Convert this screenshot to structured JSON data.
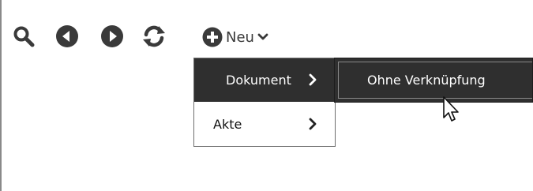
{
  "toolbar": {
    "icons": [
      "search-icon",
      "back-icon",
      "forward-icon",
      "refresh-icon"
    ],
    "new_button": {
      "icon": "plus-circle-icon",
      "label": "Neu",
      "dropdown_icon": "chevron-down-icon"
    }
  },
  "menu": {
    "items": [
      {
        "label": "Dokument",
        "has_submenu": true,
        "active": true
      },
      {
        "label": "Akte",
        "has_submenu": true,
        "active": false
      }
    ],
    "submenu": {
      "parent": "Dokument",
      "items": [
        {
          "label": "Ohne Verknüpfung",
          "hovered": true
        }
      ]
    }
  },
  "colors": {
    "icon": "#3a3a3a",
    "menu_active_bg": "#2f2f2f",
    "menu_active_text": "#ffffff",
    "menu_border": "#6e6e6e",
    "text": "#111111"
  }
}
